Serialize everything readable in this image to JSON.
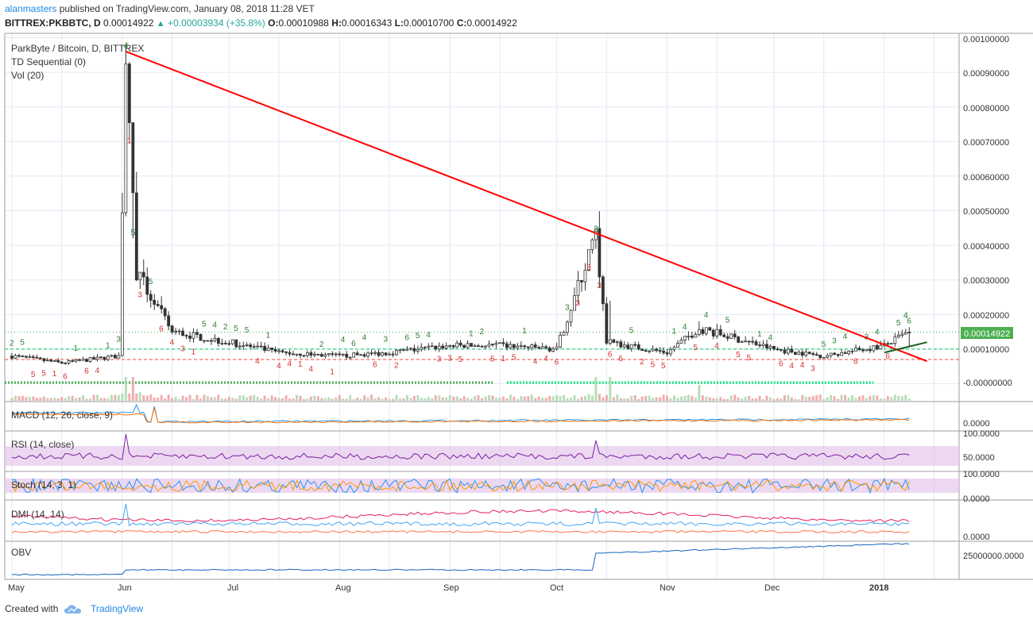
{
  "header": {
    "author": "alanmasters",
    "published_text": "published on TradingView.com, January 08, 2018 11:28 VET",
    "symbol": "BITTREX:PKBBTC, D",
    "last": "0.00014922",
    "change": "+0.00003934 (+35.8%)",
    "o_label": "O:",
    "o": "0.00010988",
    "h_label": "H:",
    "h": "0.00016343",
    "l_label": "L:",
    "l": "0.00010700",
    "c_label": "C:",
    "c": "0.00014922"
  },
  "panes": {
    "main_title": "ParkByte / Bitcoin, D, BITTREX",
    "td_title": "TD Sequential (0)",
    "vol_title": "Vol (20)",
    "macd_title": "MACD (12, 26, close, 9)",
    "rsi_title": "RSI (14, close)",
    "stoch_title": "Stoch (14, 3, 1)",
    "dmi_title": "DMI (14, 14)",
    "obv_title": "OBV"
  },
  "axes": {
    "price_ticks": [
      "0.00100000",
      "0.00090000",
      "0.00080000",
      "0.00070000",
      "0.00060000",
      "0.00050000",
      "0.00040000",
      "0.00030000",
      "0.00020000",
      "0.00010000",
      "-0.00000000"
    ],
    "macd_tick": "0.0000",
    "rsi_ticks": [
      "100.0000",
      "50.0000"
    ],
    "stoch_ticks": [
      "100.0000",
      "0.0000"
    ],
    "dmi_tick": "0.0000",
    "obv_tick": "25000000.0000",
    "last_price_label": "0.00014922",
    "x_labels": [
      "May",
      "Jun",
      "Jul",
      "Aug",
      "Sep",
      "Oct",
      "Nov",
      "Dec",
      "2018"
    ]
  },
  "footer": {
    "created_with": "Created with",
    "brand": "TradingView"
  },
  "colors": {
    "up": "#26a69a",
    "down": "#ef5350",
    "trendline": "#ff0000",
    "grid": "#e0eaf5",
    "macd": "#2196f3",
    "signal": "#ff6d00",
    "rsi": "#7b1fa2",
    "band": "#e1bee7",
    "obv": "#1565c0"
  },
  "chart_data": {
    "type": "candlestick",
    "title": "ParkByte / Bitcoin, D, BITTREX",
    "x_axis": [
      "May",
      "Jun",
      "Jul",
      "Aug",
      "Sep",
      "Oct",
      "Nov",
      "Dec",
      "2018"
    ],
    "y_range": [
      -5e-05,
      0.00105
    ],
    "price_points": [
      {
        "date": "2017-05-01",
        "close": 8e-05
      },
      {
        "date": "2017-05-15",
        "close": 6e-05
      },
      {
        "date": "2017-05-31",
        "close": 8e-05
      },
      {
        "date": "2017-06-02",
        "close": 0.00096
      },
      {
        "date": "2017-06-05",
        "close": 0.00032
      },
      {
        "date": "2017-06-15",
        "close": 0.00015
      },
      {
        "date": "2017-07-01",
        "close": 0.00012
      },
      {
        "date": "2017-07-15",
        "close": 9e-05
      },
      {
        "date": "2017-08-01",
        "close": 8e-05
      },
      {
        "date": "2017-08-15",
        "close": 9e-05
      },
      {
        "date": "2017-09-01",
        "close": 0.00011
      },
      {
        "date": "2017-09-15",
        "close": 0.00011
      },
      {
        "date": "2017-10-01",
        "close": 0.0001
      },
      {
        "date": "2017-10-12",
        "close": 0.00043
      },
      {
        "date": "2017-10-15",
        "close": 0.00012
      },
      {
        "date": "2017-11-01",
        "close": 9e-05
      },
      {
        "date": "2017-11-10",
        "close": 0.00016
      },
      {
        "date": "2017-12-01",
        "close": 0.0001
      },
      {
        "date": "2017-12-15",
        "close": 8e-05
      },
      {
        "date": "2018-01-01",
        "close": 0.00011
      },
      {
        "date": "2018-01-08",
        "close": 0.00014922
      }
    ],
    "trendline": {
      "from": {
        "date": "2017-06-02",
        "price": 0.00096
      },
      "to": {
        "date": "2018-01-08",
        "price": 7e-05
      }
    },
    "horizontal_levels": [
      {
        "price": 0.00014922,
        "style": "dotted",
        "color": "green"
      },
      {
        "price": 0.0001,
        "style": "dashed",
        "color": "green"
      },
      {
        "price": 7e-05,
        "style": "dashed",
        "color": "red"
      }
    ]
  }
}
